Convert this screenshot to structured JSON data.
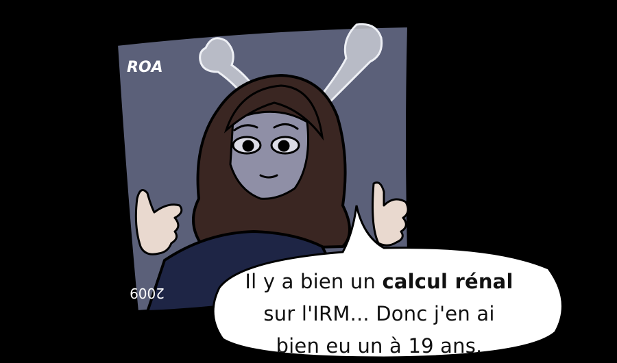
{
  "xray": {
    "label_top": "ROA",
    "year": "2009"
  },
  "speech_bubble": {
    "line1_before": "Il y a bien un ",
    "line1_emphasis": "calcul rénal",
    "line2": "sur l'IRM... Donc j'en ai",
    "line3": "bien eu un à 19 ans."
  },
  "colors": {
    "background": "#000000",
    "xray_film": "#5b6079",
    "hair": "#3a2622",
    "skin": "#e9d9cf",
    "sweater": "#1e2545",
    "bubble": "#ffffff"
  }
}
